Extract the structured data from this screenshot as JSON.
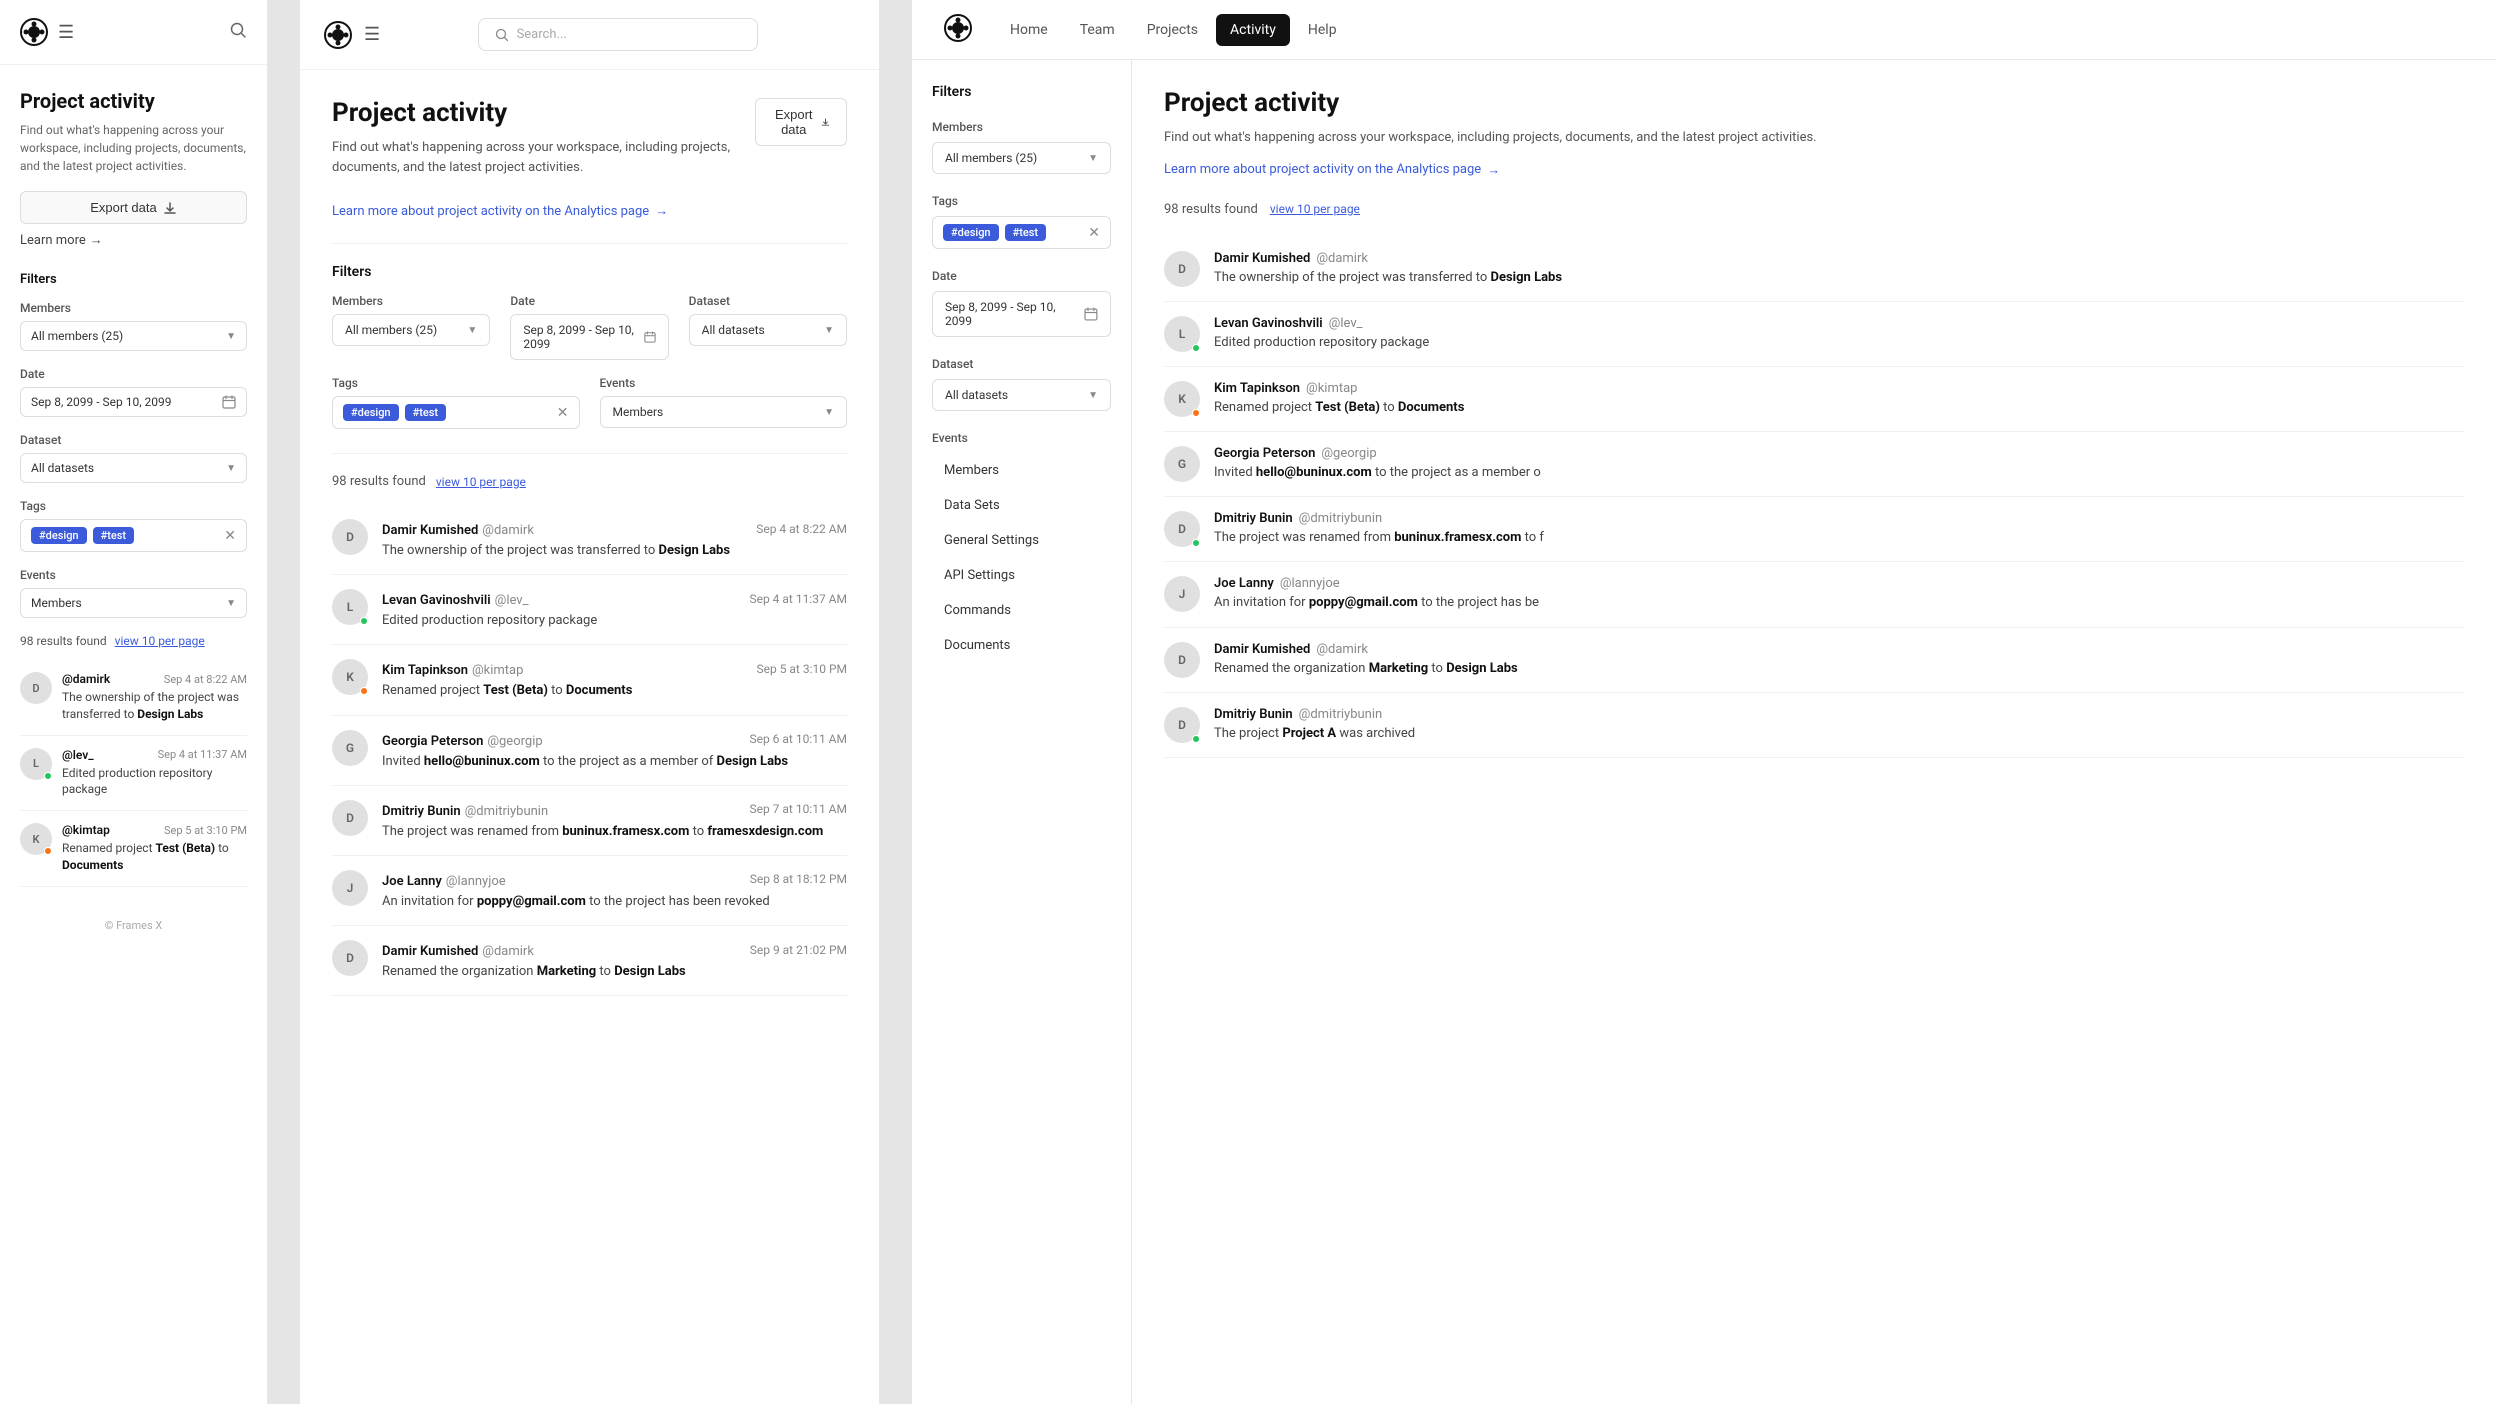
{
  "app": {
    "title": "Project activity"
  },
  "left": {
    "title": "Project activity",
    "subtitle": "Find out what's happening across your workspace, including projects, documents, and the latest project activities.",
    "export_btn": "Export data",
    "learn_more": "Learn more",
    "filters_title": "Filters",
    "members_label": "Members",
    "members_value": "All members (25)",
    "date_label": "Date",
    "date_value": "Sep 8, 2099 - Sep 10, 2099",
    "dataset_label": "Dataset",
    "dataset_value": "All datasets",
    "tags_label": "Tags",
    "tags": [
      "#design",
      "#test"
    ],
    "events_label": "Events",
    "events_value": "Members",
    "results_count": "98 results found",
    "view_per_page": "view 10 per page",
    "activity": [
      {
        "username": "@damirk",
        "time": "Sep 4 at 8:22 AM",
        "desc": "The ownership of the project was transferred to ",
        "desc_bold": "Design Labs",
        "dot": null
      },
      {
        "username": "@lev_",
        "time": "Sep 4 at 11:37 AM",
        "desc": "Edited production repository package",
        "desc_bold": "",
        "dot": "green"
      },
      {
        "username": "@kimtap",
        "time": "Sep 5 at 3:10 PM",
        "desc": "Renamed project ",
        "desc_bold": "Test (Beta)",
        "desc_after": " to ",
        "desc_bold2": "Documents",
        "dot": "orange"
      }
    ]
  },
  "middle": {
    "title": "Project activity",
    "subtitle": "Find out what's happening across your workspace, including projects, documents, and the latest project activities.",
    "export_btn": "Export data",
    "learn_more_text": "Learn more about project activity on the Analytics page",
    "filters_title": "Filters",
    "members_label": "Members",
    "members_value": "All members (25)",
    "date_label": "Date",
    "date_value": "Sep 8, 2099 - Sep 10, 2099",
    "dataset_label": "Dataset",
    "dataset_value": "All datasets",
    "tags_label": "Tags",
    "tags": [
      "#design",
      "#test"
    ],
    "events_label": "Events",
    "events_value": "Members",
    "results_count": "98 results found",
    "view_per_page": "view 10 per page",
    "activity": [
      {
        "name": "Damir Kumished",
        "handle": "@damirk",
        "time": "Sep 4 at 8:22 AM",
        "desc": "The ownership of the project was transferred to ",
        "desc_bold": "Design Labs",
        "dot": null
      },
      {
        "name": "Levan Gavinoshvili",
        "handle": "@lev_",
        "time": "Sep 4 at 11:37 AM",
        "desc": "Edited production repository package",
        "desc_bold": "",
        "dot": "green"
      },
      {
        "name": "Kim Tapinkson",
        "handle": "@kimtap",
        "time": "Sep 5 at 3:10 PM",
        "desc_pre": "Renamed project ",
        "desc_bold": "Test (Beta)",
        "desc_mid": " to ",
        "desc_bold2": "Documents",
        "dot": "orange"
      },
      {
        "name": "Georgia Peterson",
        "handle": "@georgip",
        "time": "Sep 6 at 10:11 AM",
        "desc_pre": "Invited ",
        "desc_bold": "hello@buninux.com",
        "desc_mid": " to the project as a member of ",
        "desc_bold2": "Design Labs",
        "dot": null
      },
      {
        "name": "Dmitriy Bunin",
        "handle": "@dmitriybunin",
        "time": "Sep 7 at 10:11 AM",
        "desc_pre": "The project was renamed from ",
        "desc_bold": "buninux.framesx.com",
        "desc_mid": " to ",
        "desc_bold2": "framesxdesign.com",
        "dot": null
      },
      {
        "name": "Joe Lanny",
        "handle": "@lannyjoe",
        "time": "Sep 8 at 18:12 PM",
        "desc_pre": "An invitation for ",
        "desc_bold": "poppy@gmail.com",
        "desc_mid": " to the project has been revoked",
        "desc_bold2": "",
        "dot": null
      },
      {
        "name": "Damir Kumished",
        "handle": "@damirk",
        "time": "Sep 9 at 21:02 PM",
        "desc_pre": "Renamed the organization ",
        "desc_bold": "Marketing",
        "desc_mid": " to ",
        "desc_bold2": "Design Labs",
        "dot": null
      }
    ]
  },
  "right": {
    "nav": {
      "links": [
        "Home",
        "Team",
        "Projects",
        "Activity",
        "Help"
      ],
      "active": "Activity"
    },
    "filters_title": "Filters",
    "members_label": "Members",
    "members_value": "All members (25)",
    "tags_label": "Tags",
    "tags": [
      "#design",
      "#test"
    ],
    "date_label": "Date",
    "date_value": "Sep 8, 2099 - Sep 10, 2099",
    "dataset_label": "Dataset",
    "dataset_value": "All datasets",
    "events_label": "Events",
    "events_items": [
      "Members",
      "Data Sets",
      "General Settings",
      "API Settings",
      "Commands",
      "Documents"
    ],
    "title": "Project activity",
    "subtitle": "Find out what's happening across your workspace, including projects, documents, and the latest project activities.",
    "learn_more_text": "Learn more about project activity on the Analytics page",
    "results_count": "98 results found",
    "view_per_page": "view 10 per page",
    "activity": [
      {
        "name": "Damir Kumished",
        "handle": "@damirk",
        "desc_pre": "The ownership of the project was transferred to ",
        "desc_bold": "Design Labs",
        "desc_mid": "",
        "dot": null
      },
      {
        "name": "Levan Gavinoshvili",
        "handle": "@lev_",
        "desc_pre": "Edited production repository package",
        "desc_bold": "",
        "dot": "green"
      },
      {
        "name": "Kim Tapinkson",
        "handle": "@kimtap",
        "desc_pre": "Renamed project ",
        "desc_bold": "Test (Beta)",
        "desc_mid": " to ",
        "desc_bold2": "Documents",
        "dot": "orange"
      },
      {
        "name": "Georgia Peterson",
        "handle": "@georgip",
        "desc_pre": "Invited ",
        "desc_bold": "hello@buninux.com",
        "desc_mid": " to the project as a member of",
        "dot": null
      },
      {
        "name": "Dmitriy Bunin",
        "handle": "@dmitriybunin",
        "desc_pre": "The project was renamed from ",
        "desc_bold": "buninux.framesx.com",
        "desc_mid": " to f",
        "dot": null
      },
      {
        "name": "Joe Lanny",
        "handle": "@lannyjoe",
        "desc_pre": "An invitation for ",
        "desc_bold": "poppy@gmail.com",
        "desc_mid": " to the project has be",
        "dot": null
      },
      {
        "name": "Damir Kumished",
        "handle": "@damirk",
        "desc_pre": "Renamed the organization ",
        "desc_bold": "Marketing",
        "desc_mid": " to ",
        "desc_bold2": "Design Labs",
        "dot": null
      },
      {
        "name": "Dmitriy Bunin",
        "handle": "@dmitriybunin",
        "desc_pre": "The project ",
        "desc_bold": "Project A",
        "desc_mid": " was archived",
        "dot": null
      }
    ]
  }
}
